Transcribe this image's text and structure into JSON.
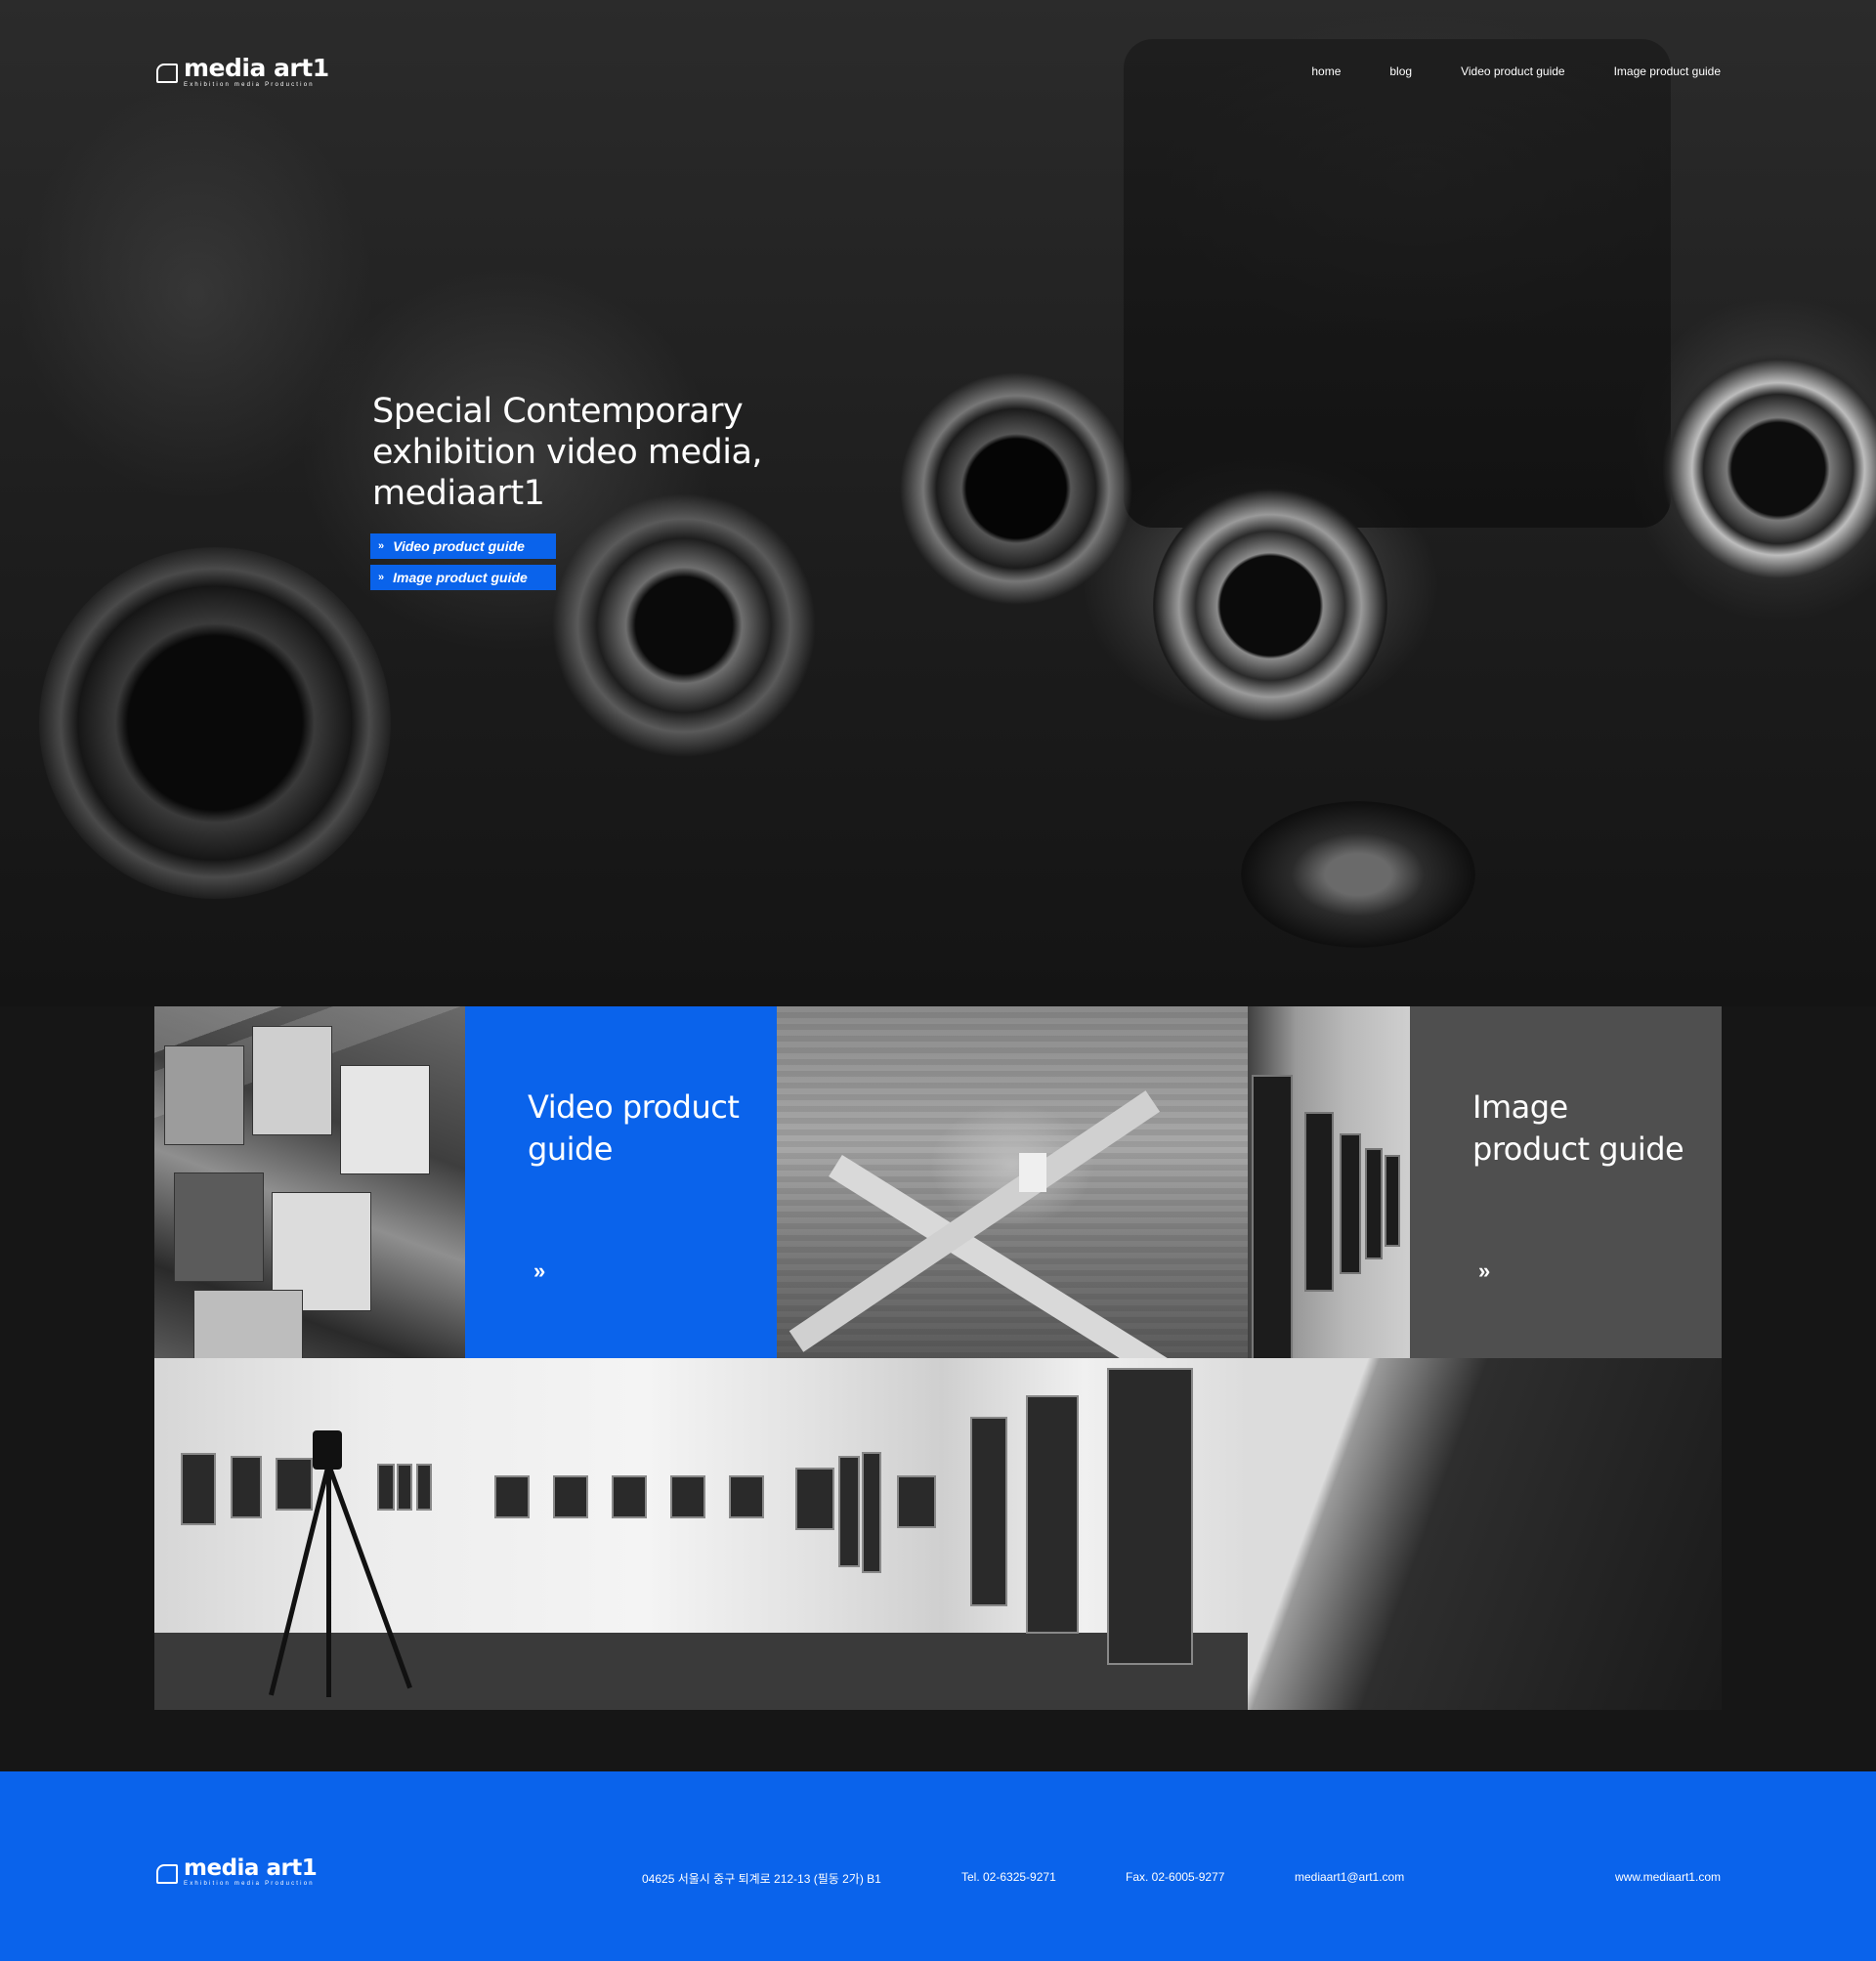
{
  "brand": {
    "name": "media art1",
    "tagline": "Exhibition media Production",
    "accent_color": "#0a63eb"
  },
  "nav": {
    "items": [
      "home",
      "blog",
      "Video product guide",
      "Image product guide"
    ]
  },
  "hero": {
    "title": "Special Contemporary exhibition video media, mediaart1",
    "buttons": [
      {
        "label": "Video product guide",
        "icon": "double-chevron-right-icon"
      },
      {
        "label": "Image product guide",
        "icon": "double-chevron-right-icon"
      }
    ]
  },
  "tiles": {
    "video": {
      "title": "Video product guide",
      "arrow": "»",
      "color": "#0a63eb"
    },
    "image": {
      "title": "Image product guide",
      "arrow": "»",
      "color": "#4f4f4f"
    }
  },
  "footer": {
    "address": "04625 서울시 중구 퇴계로 212-13 (필동 2가) B1",
    "tel": "Tel. 02-6325-9271",
    "fax": "Fax. 02-6005-9277",
    "email": "mediaart1@art1.com",
    "website": "www.mediaart1.com"
  }
}
